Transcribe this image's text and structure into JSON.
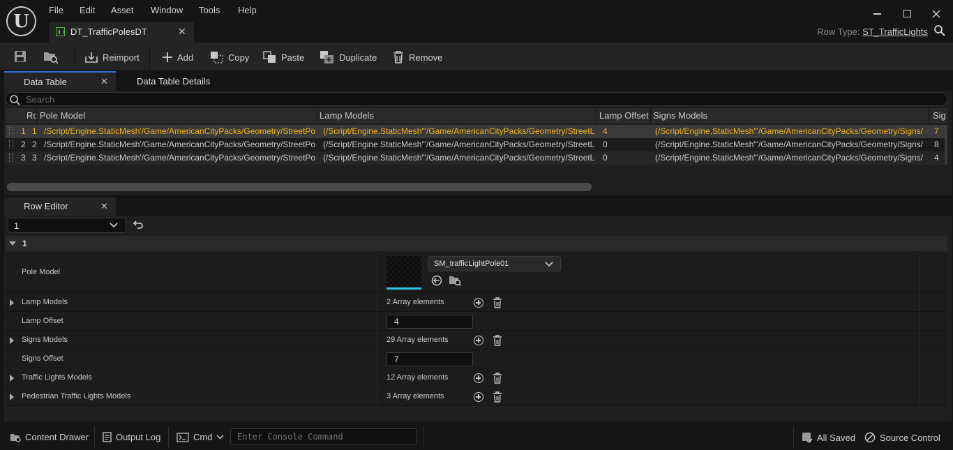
{
  "menu": [
    "File",
    "Edit",
    "Asset",
    "Window",
    "Tools",
    "Help"
  ],
  "logo_text": "U",
  "document_tab": {
    "title": "DT_TrafficPolesDT"
  },
  "row_type": {
    "label": "Row Type:",
    "value": "ST_TrafficLights"
  },
  "toolbar": {
    "reimport": "Reimport",
    "add": "Add",
    "copy": "Copy",
    "paste": "Paste",
    "duplicate": "Duplicate",
    "remove": "Remove"
  },
  "tabs": {
    "data_table": "Data Table",
    "data_table_details": "Data Table Details"
  },
  "search": {
    "placeholder": "Search"
  },
  "grid": {
    "columns": [
      "Rc",
      "Pole Model",
      "Lamp Models",
      "Lamp Offset",
      "Signs Models",
      "Sig"
    ],
    "rows": [
      {
        "index": "1",
        "name": "1",
        "pole": "/Script/Engine.StaticMesh'/Game/AmericanCityPacks/Geometry/StreetPo",
        "lamp": "(/Script/Engine.StaticMesh'\"/Game/AmericanCityPacks/Geometry/StreetL",
        "offset": "4",
        "signs": "(/Script/Engine.StaticMesh'\"/Game/AmericanCityPacks/Geometry/Signs/",
        "sig": "7",
        "selected": true
      },
      {
        "index": "2",
        "name": "2",
        "pole": "/Script/Engine.StaticMesh'/Game/AmericanCityPacks/Geometry/StreetPo",
        "lamp": "(/Script/Engine.StaticMesh'\"/Game/AmericanCityPacks/Geometry/StreetL",
        "offset": "0",
        "signs": "(/Script/Engine.StaticMesh'\"/Game/AmericanCityPacks/Geometry/Signs/",
        "sig": "8",
        "selected": false
      },
      {
        "index": "3",
        "name": "3",
        "pole": "/Script/Engine.StaticMesh'/Game/AmericanCityPacks/Geometry/StreetPo",
        "lamp": "(/Script/Engine.StaticMesh'\"/Game/AmericanCityPacks/Geometry/StreetL",
        "offset": "0",
        "signs": "(/Script/Engine.StaticMesh'\"/Game/AmericanCityPacks/Geometry/Signs/",
        "sig": "4",
        "selected": false
      }
    ]
  },
  "row_editor": {
    "tab": "Row Editor",
    "selected_row": "1",
    "section": "1",
    "pole_model": {
      "label": "Pole Model",
      "asset": "SM_trafficLightPole01"
    },
    "lamp_models": {
      "label": "Lamp Models",
      "value": "2 Array elements"
    },
    "lamp_offset": {
      "label": "Lamp Offset",
      "value": "4"
    },
    "signs_models": {
      "label": "Signs Models",
      "value": "29 Array elements"
    },
    "signs_offset": {
      "label": "Signs Offset",
      "value": "7"
    },
    "traffic_lights_models": {
      "label": "Traffic Lights Models",
      "value": "12 Array elements"
    },
    "pedestrian_models": {
      "label": "Pedestrian Traffic Lights Models",
      "value": "3 Array elements"
    }
  },
  "statusbar": {
    "content_drawer": "Content Drawer",
    "output_log": "Output Log",
    "cmd": "Cmd",
    "console_placeholder": "Enter Console Command",
    "all_saved": "All Saved",
    "source_control": "Source Control"
  },
  "colors": {
    "selected_text": "#f0b418",
    "accent": "#2d6fd4",
    "cyan_bar": "#2ec8e6"
  }
}
